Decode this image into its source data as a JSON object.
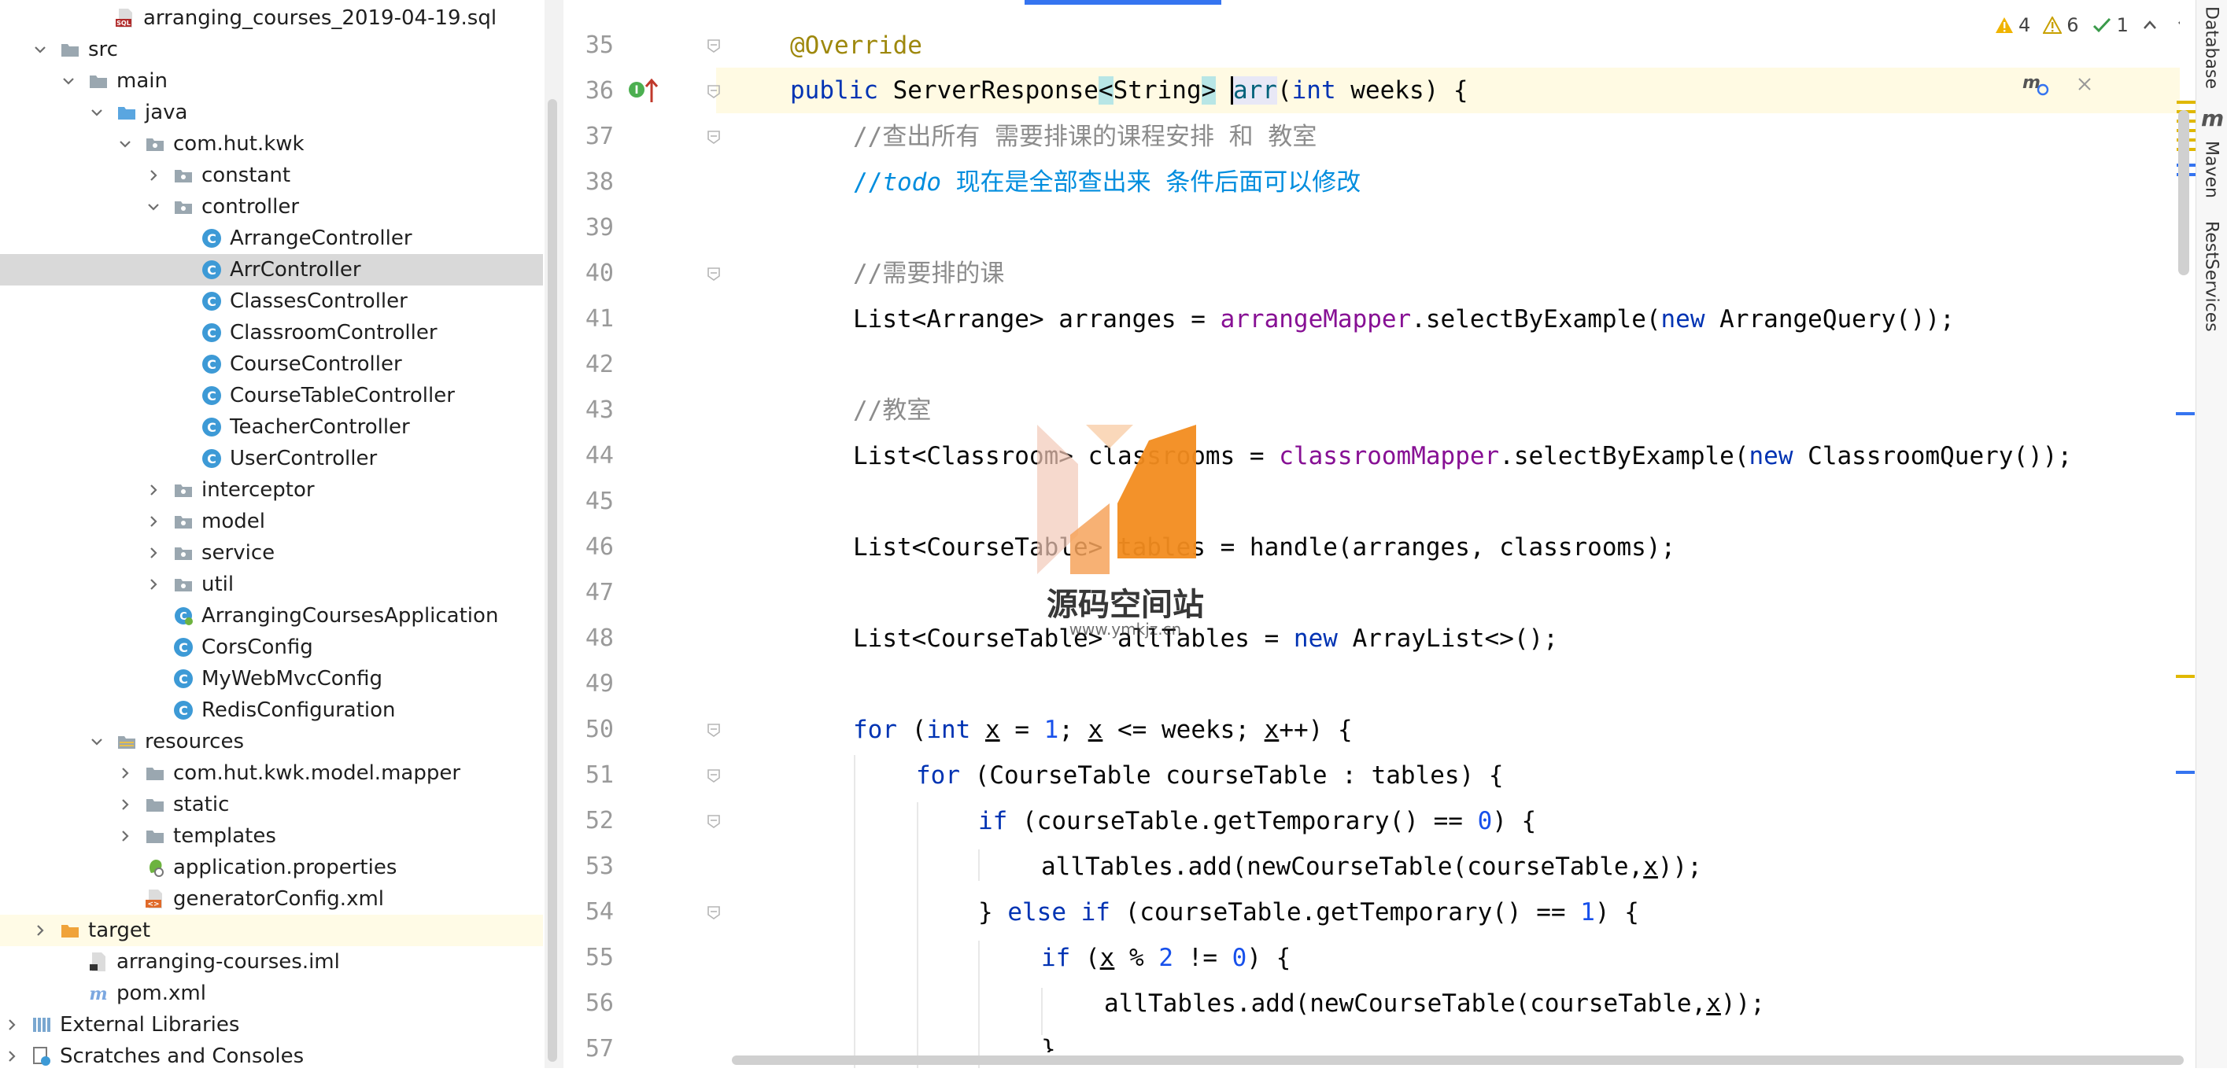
{
  "tree": [
    {
      "label": "arranging_courses_2019-04-19.sql",
      "indent": 110,
      "icon": "sql-file-icon",
      "chev": "none"
    },
    {
      "label": "src",
      "indent": 40,
      "icon": "folder-icon",
      "chev": "down"
    },
    {
      "label": "main",
      "indent": 76,
      "icon": "folder-icon",
      "chev": "down"
    },
    {
      "label": "java",
      "indent": 112,
      "icon": "source-folder-icon",
      "chev": "down"
    },
    {
      "label": "com.hut.kwk",
      "indent": 148,
      "icon": "package-icon",
      "chev": "down"
    },
    {
      "label": "constant",
      "indent": 184,
      "icon": "package-icon",
      "chev": "right"
    },
    {
      "label": "controller",
      "indent": 184,
      "icon": "package-icon",
      "chev": "down"
    },
    {
      "label": "ArrangeController",
      "indent": 220,
      "icon": "class-icon",
      "chev": "none"
    },
    {
      "label": "ArrController",
      "indent": 220,
      "icon": "class-icon",
      "chev": "none",
      "selected": true
    },
    {
      "label": "ClassesController",
      "indent": 220,
      "icon": "class-icon",
      "chev": "none"
    },
    {
      "label": "ClassroomController",
      "indent": 220,
      "icon": "class-icon",
      "chev": "none"
    },
    {
      "label": "CourseController",
      "indent": 220,
      "icon": "class-icon",
      "chev": "none"
    },
    {
      "label": "CourseTableController",
      "indent": 220,
      "icon": "class-icon",
      "chev": "none"
    },
    {
      "label": "TeacherController",
      "indent": 220,
      "icon": "class-icon",
      "chev": "none"
    },
    {
      "label": "UserController",
      "indent": 220,
      "icon": "class-icon",
      "chev": "none"
    },
    {
      "label": "interceptor",
      "indent": 184,
      "icon": "package-icon",
      "chev": "right"
    },
    {
      "label": "model",
      "indent": 184,
      "icon": "package-icon",
      "chev": "right"
    },
    {
      "label": "service",
      "indent": 184,
      "icon": "package-icon",
      "chev": "right"
    },
    {
      "label": "util",
      "indent": 184,
      "icon": "package-icon",
      "chev": "right"
    },
    {
      "label": "ArrangingCoursesApplication",
      "indent": 184,
      "icon": "spring-class-icon",
      "chev": "none"
    },
    {
      "label": "CorsConfig",
      "indent": 184,
      "icon": "class-icon",
      "chev": "none"
    },
    {
      "label": "MyWebMvcConfig",
      "indent": 184,
      "icon": "class-icon",
      "chev": "none"
    },
    {
      "label": "RedisConfiguration",
      "indent": 184,
      "icon": "class-icon",
      "chev": "none"
    },
    {
      "label": "resources",
      "indent": 112,
      "icon": "resources-folder-icon",
      "chev": "down"
    },
    {
      "label": "com.hut.kwk.model.mapper",
      "indent": 148,
      "icon": "folder-icon",
      "chev": "right"
    },
    {
      "label": "static",
      "indent": 148,
      "icon": "folder-icon",
      "chev": "right"
    },
    {
      "label": "templates",
      "indent": 148,
      "icon": "folder-icon",
      "chev": "right"
    },
    {
      "label": "application.properties",
      "indent": 148,
      "icon": "properties-file-icon",
      "chev": "none"
    },
    {
      "label": "generatorConfig.xml",
      "indent": 148,
      "icon": "xml-file-icon",
      "chev": "none"
    },
    {
      "label": "target",
      "indent": 40,
      "icon": "orange-folder-icon",
      "chev": "right",
      "highlight": true
    },
    {
      "label": "arranging-courses.iml",
      "indent": 76,
      "icon": "iml-file-icon",
      "chev": "none"
    },
    {
      "label": "pom.xml",
      "indent": 76,
      "icon": "maven-file-icon",
      "chev": "none"
    },
    {
      "label": "External Libraries",
      "indent": 4,
      "icon": "libraries-icon",
      "chev": "right"
    },
    {
      "label": "Scratches and Consoles",
      "indent": 4,
      "icon": "scratches-icon",
      "chev": "right"
    }
  ],
  "lines": [
    "35",
    "36",
    "37",
    "38",
    "39",
    "40",
    "41",
    "42",
    "43",
    "44",
    "45",
    "46",
    "47",
    "48",
    "49",
    "50",
    "51",
    "52",
    "53",
    "54",
    "55",
    "56",
    "57"
  ],
  "code": {
    "l35": "@Override",
    "l36a": "public",
    "l36b": " ServerResponse",
    "l36c": "<",
    "l36d": "String",
    "l36e": ">",
    "l36f": " ",
    "l36g": "arr",
    "l36h": "(",
    "l36i": "int",
    "l36j": " weeks) {",
    "l37": "//查出所有 需要排课的课程安排 和 教室",
    "l38a": "//",
    "l38b": "todo",
    "l38c": " 现在是全部查出来 条件后面可以修改",
    "l40": "//需要排的课",
    "l41a": "List<Arrange> arranges = ",
    "l41b": "arrangeMapper",
    "l41c": ".selectByExample(",
    "l41d": "new",
    "l41e": " ArrangeQuery());",
    "l43": "//教室",
    "l44a": "List<Classroom> classrooms = ",
    "l44b": "classroomMapper",
    "l44c": ".selectByExample(",
    "l44d": "new",
    "l44e": " ClassroomQuery());",
    "l46": "List<CourseTable> tables = handle(arranges, classrooms);",
    "l48a": "List<CourseTable> allTables = ",
    "l48b": "new",
    "l48c": " ArrayList<>();",
    "l50a": "for",
    "l50b": " (",
    "l50c": "int",
    "l50d": " ",
    "l50e": "x",
    "l50f": " = ",
    "l50g": "1",
    "l50h": "; ",
    "l50i": "x",
    "l50j": " <= weeks; ",
    "l50k": "x",
    "l50l": "++) {",
    "l51a": "for",
    "l51b": " (CourseTable courseTable : tables) {",
    "l52a": "if",
    "l52b": " (courseTable.getTemporary() == ",
    "l52c": "0",
    "l52d": ") {",
    "l53a": "allTables.add(newCourseTable(courseTable,",
    "l53b": "x",
    "l53c": "));",
    "l54a": "} ",
    "l54b": "else if",
    "l54c": " (courseTable.getTemporary() == ",
    "l54d": "1",
    "l54e": ") {",
    "l55a": "if",
    "l55b": " (",
    "l55c": "x",
    "l55d": " % ",
    "l55e": "2",
    "l55f": " != ",
    "l55g": "0",
    "l55h": ") {",
    "l56a": "allTables.add(newCourseTable(courseTable,",
    "l56b": "x",
    "l56c": "));",
    "l57": "}"
  },
  "inspections": {
    "warnings": "4",
    "weak_warnings": "6",
    "typos": "1"
  },
  "tool_tabs": {
    "database": "Database",
    "maven": "Maven",
    "rest": "RestServices"
  },
  "watermark": {
    "title": "源码空间站",
    "subtitle": "www.ymkjz.cn"
  },
  "colors": {
    "keyword": "#0033b3",
    "annotation": "#9e880d",
    "comment": "#8c8c8c",
    "todo": "#008dde",
    "field": "#871094",
    "number": "#1750eb",
    "selection": "#d9d9d9",
    "class_icon": "#3d9ad6",
    "accent": "#3574f0"
  }
}
